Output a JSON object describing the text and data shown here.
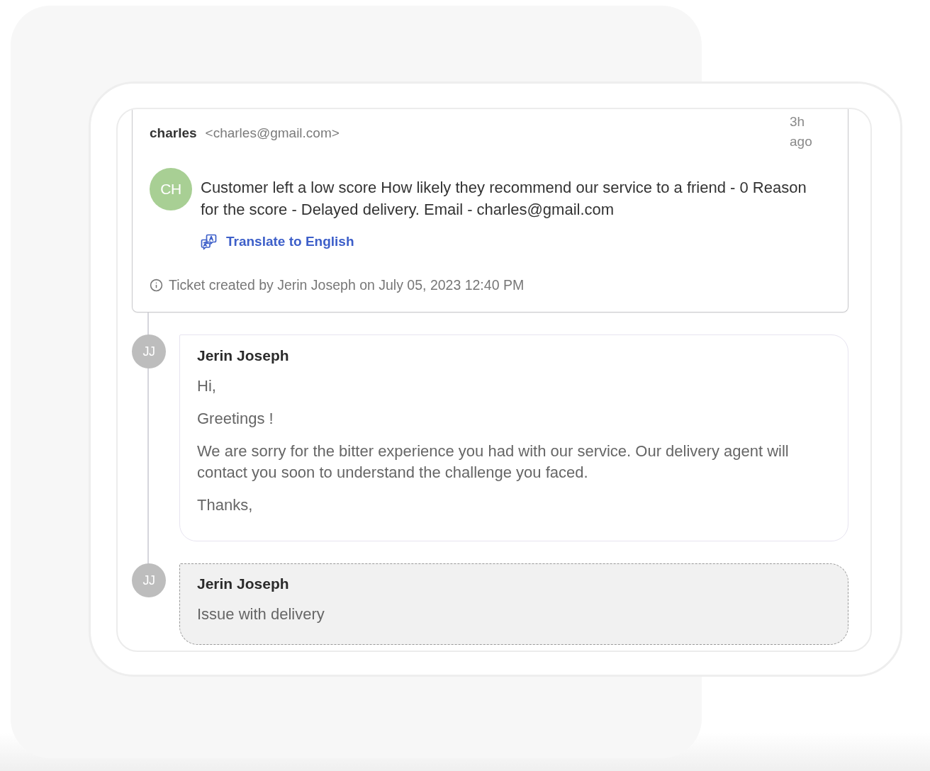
{
  "conversation": {
    "sender": {
      "name": "charles",
      "email": "<charles@gmail.com>",
      "initials": "CH",
      "time": "3h ago"
    },
    "message": "Customer left a low score How likely they recommend our service to a friend - 0 Reason for the score - Delayed delivery. Email - charles@gmail.com",
    "translate_link": "Translate to English",
    "created_note": "Ticket created by Jerin Joseph on July 05, 2023 12:40 PM"
  },
  "thread": [
    {
      "kind": "reply",
      "initials": "JJ",
      "author": "Jerin Joseph",
      "paragraphs": [
        "Hi,",
        "Greetings !",
        "We are sorry for the bitter experience you had with our service. Our delivery agent will contact you soon to understand the challenge you faced.",
        "Thanks,"
      ]
    },
    {
      "kind": "note",
      "initials": "JJ",
      "author": "Jerin Joseph",
      "paragraphs": [
        "Issue with delivery"
      ]
    }
  ]
}
